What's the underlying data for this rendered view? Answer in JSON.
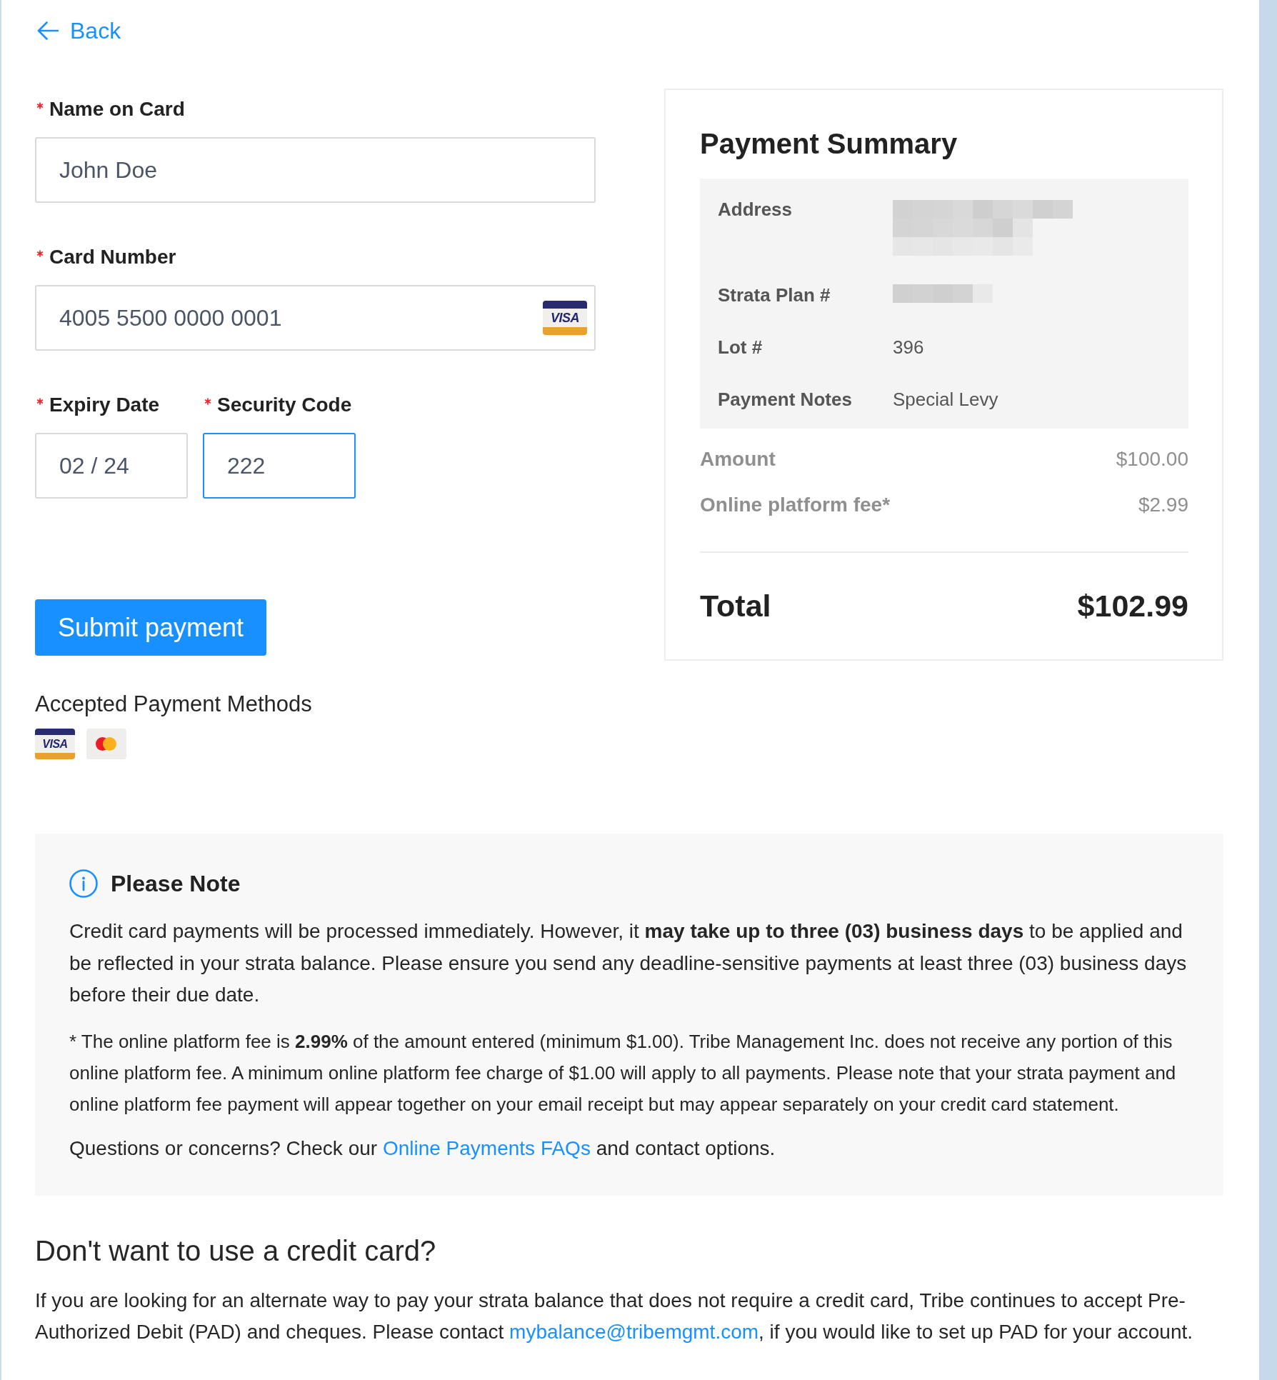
{
  "back_link": {
    "label": "Back"
  },
  "form": {
    "rows": [
      {
        "fields": [
          {
            "label": "Name on Card",
            "required": true,
            "value": "John Doe",
            "focused": false
          }
        ]
      },
      {
        "fields": [
          {
            "label": "Card Number",
            "required": true,
            "value": "4005 5500 0000 0001",
            "focused": false,
            "card_icon": {
              "kind": "visa",
              "text": "VISA"
            }
          }
        ]
      },
      {
        "fields": [
          {
            "label": "Expiry Date",
            "required": true,
            "value": "02 / 24",
            "focused": false
          },
          {
            "label": "Security Code",
            "required": true,
            "value": "222",
            "focused": true
          }
        ]
      }
    ]
  },
  "submit_button": {
    "label": "Submit payment"
  },
  "accepted_methods": {
    "title": "Accepted Payment Methods",
    "cards": [
      {
        "kind": "visa",
        "text": "VISA"
      },
      {
        "kind": "mastercard"
      }
    ]
  },
  "summary": {
    "title": "Payment Summary",
    "details": [
      {
        "label": "Address",
        "redacted": true
      },
      {
        "label": "Strata Plan #",
        "redacted": true
      },
      {
        "label": "Lot #",
        "redacted": false,
        "value": "396"
      },
      {
        "label": "Payment Notes",
        "redacted": false,
        "value": "Special Levy"
      }
    ],
    "charges": [
      {
        "label": "Amount",
        "value": "$100.00"
      },
      {
        "label": "Online platform fee*",
        "value": "$2.99"
      }
    ],
    "total": {
      "label": "Total",
      "value": "$102.99"
    }
  },
  "note": {
    "title": "Please Note",
    "paragraphs": [
      {
        "kind": "main",
        "text": "Credit card payments will be processed immediately. However, it **may take up to three (03) business days** to be applied and be reflected in your strata balance. Please ensure you send any deadline-sensitive payments at least three (03) business days before their due date."
      },
      {
        "kind": "fine_print",
        "text": "* The online platform fee is **2.99%** of the amount entered (minimum $1.00). Tribe Management Inc. does not receive any portion of this online platform fee. A minimum online platform fee charge of $1.00 will apply to all payments. Please note that your strata payment and online platform fee payment will appear together on your email receipt but may appear separately on your credit card statement."
      },
      {
        "kind": "link",
        "before": "Questions or concerns? Check our ",
        "link": "Online Payments FAQs",
        "after": " and contact options."
      }
    ]
  },
  "alternative": {
    "title": "Don't want to use a credit card?",
    "before": "If you are looking for an alternate way to pay your strata balance that does not require a credit card, Tribe continues to accept Pre-Authorized Debit (PAD) and cheques. Please contact ",
    "link": "mybalance@tribemgmt.com",
    "after": ", if you would like to set up PAD for your account."
  }
}
